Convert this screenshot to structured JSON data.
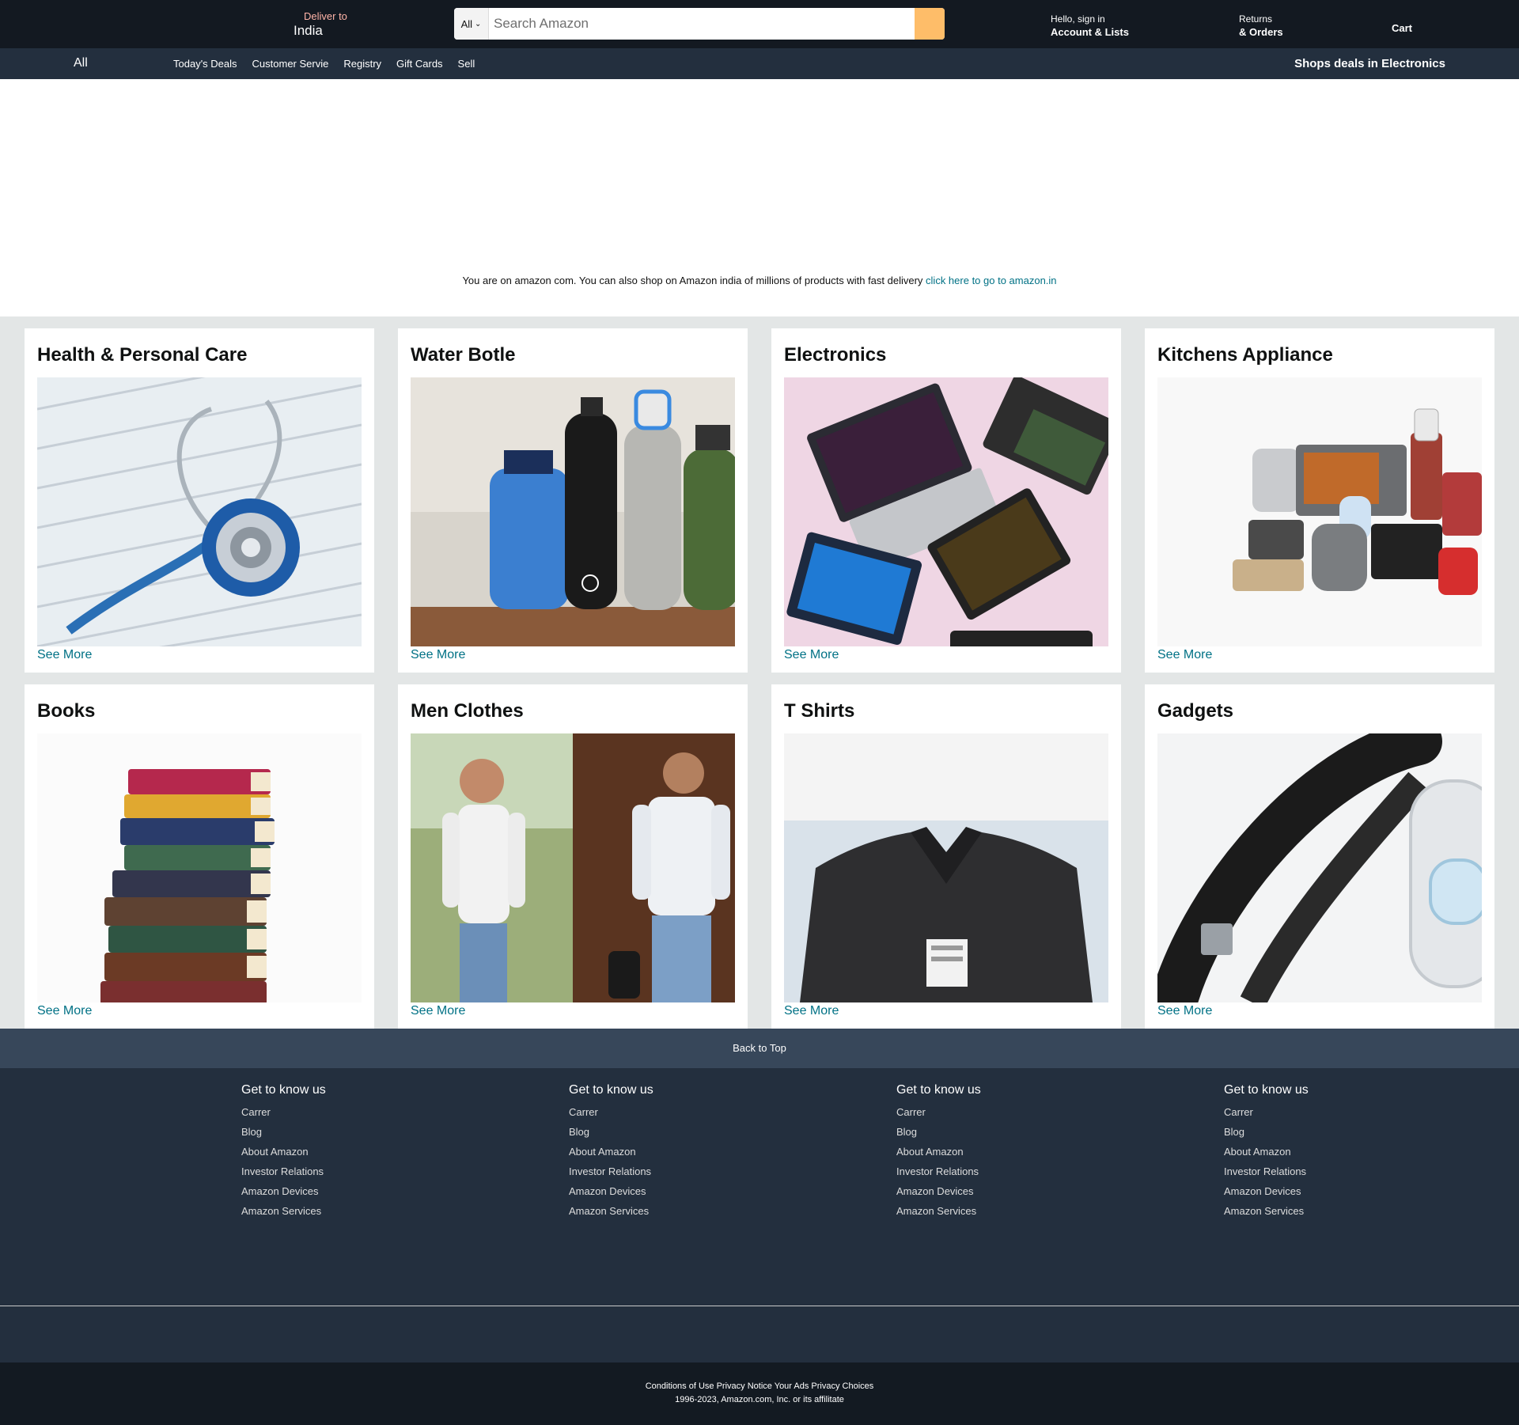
{
  "header": {
    "deliver_label": "Deliver to",
    "deliver_location": "India",
    "search_category": "All",
    "search_placeholder": "Search Amazon",
    "account_greeting": "Hello, sign in",
    "account_label": "Account & Lists",
    "returns_label": "Returns",
    "orders_label": "& Orders",
    "cart_label": "Cart"
  },
  "subnav": {
    "all_label": "All",
    "links": [
      "Today's Deals",
      "Customer Servie",
      "Registry",
      "Gift Cards",
      "Sell"
    ],
    "promo": "Shops deals in Electronics"
  },
  "banner": {
    "message": "You are on amazon com. You can also shop on Amazon india of millions of products with fast delivery ",
    "link_text": "click here to go to amazon.in"
  },
  "cards": [
    {
      "title": "Health & Personal Care",
      "link": "See More",
      "image": "stethoscope"
    },
    {
      "title": "Water Botle",
      "link": "See More",
      "image": "water-bottles"
    },
    {
      "title": "Electronics",
      "link": "See More",
      "image": "laptops"
    },
    {
      "title": "Kitchens Appliance",
      "link": "See More",
      "image": "kitchen-appliances"
    },
    {
      "title": "Books",
      "link": "See More",
      "image": "book-stack"
    },
    {
      "title": "Men Clothes",
      "link": "See More",
      "image": "men-shirts"
    },
    {
      "title": "T Shirts",
      "link": "See More",
      "image": "polo-shirt"
    },
    {
      "title": "Gadgets",
      "link": "See More",
      "image": "headphones"
    }
  ],
  "footer": {
    "back_to_top": "Back to Top",
    "columns": [
      {
        "heading": "Get to know us",
        "links": [
          "Carrer",
          "Blog",
          "About Amazon",
          "Investor Relations",
          "Amazon Devices",
          "Amazon Services"
        ]
      },
      {
        "heading": "Get to know us",
        "links": [
          "Carrer",
          "Blog",
          "About Amazon",
          "Investor Relations",
          "Amazon Devices",
          "Amazon Services"
        ]
      },
      {
        "heading": "Get to know us",
        "links": [
          "Carrer",
          "Blog",
          "About Amazon",
          "Investor Relations",
          "Amazon Devices",
          "Amazon Services"
        ]
      },
      {
        "heading": "Get to know us",
        "links": [
          "Carrer",
          "Blog",
          "About Amazon",
          "Investor Relations",
          "Amazon Devices",
          "Amazon Services"
        ]
      }
    ],
    "legal_links": "Conditions of Use Privacy Notice Your Ads Privacy Choices",
    "copyright": "1996-2023, Amazon.com, Inc. or its affilitate"
  },
  "colors": {
    "header_bg": "#131921",
    "subnav_bg": "#232f3e",
    "search_button": "#febd69",
    "link": "#007185",
    "page_bg": "#e3e6e6"
  }
}
